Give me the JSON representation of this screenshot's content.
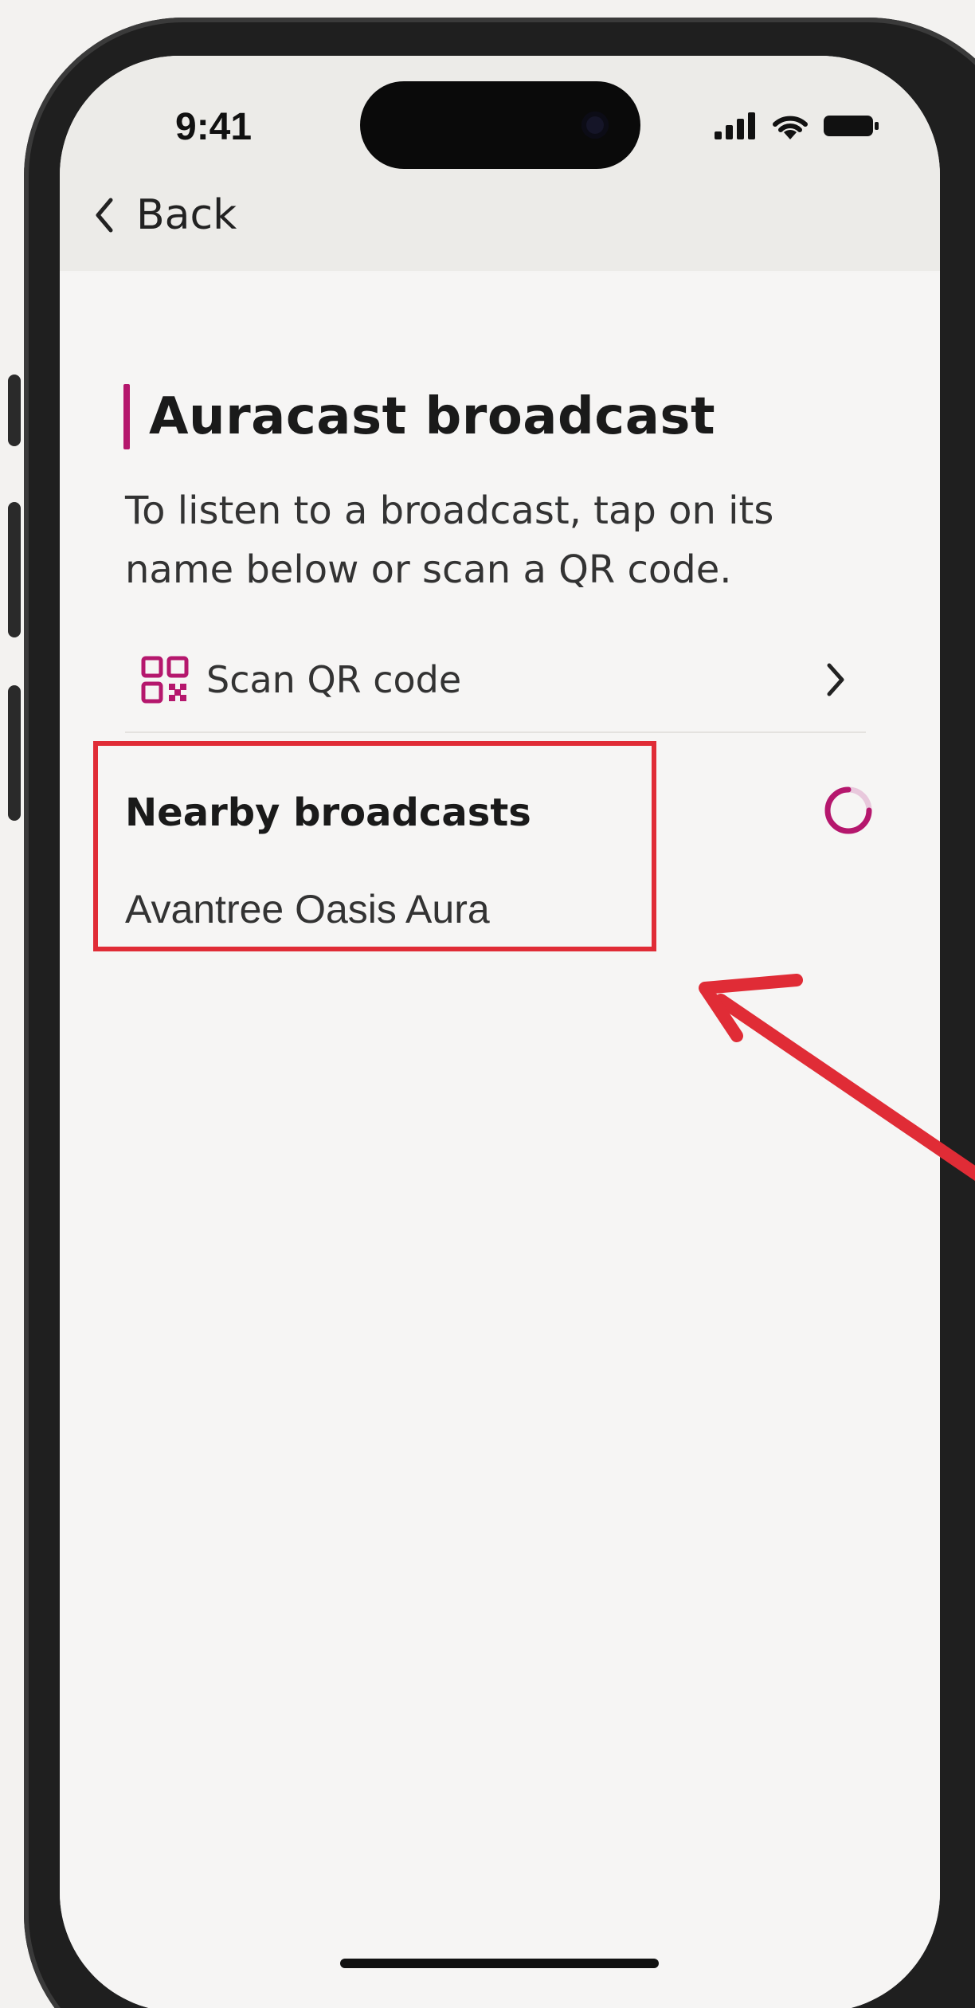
{
  "status_bar": {
    "time": "9:41",
    "icons": [
      "signal-icon",
      "wifi-icon",
      "battery-icon"
    ]
  },
  "nav": {
    "back_label": "Back"
  },
  "page": {
    "title": "Auracast broadcast",
    "description": "To listen to a broadcast, tap on its name below or scan a QR code."
  },
  "scan": {
    "label": "Scan QR code"
  },
  "nearby": {
    "title": "Nearby broadcasts",
    "items": [
      {
        "name": "Avantree Oasis Aura"
      }
    ]
  },
  "colors": {
    "accent": "#b5176d",
    "annotation_red": "#e02c36"
  }
}
